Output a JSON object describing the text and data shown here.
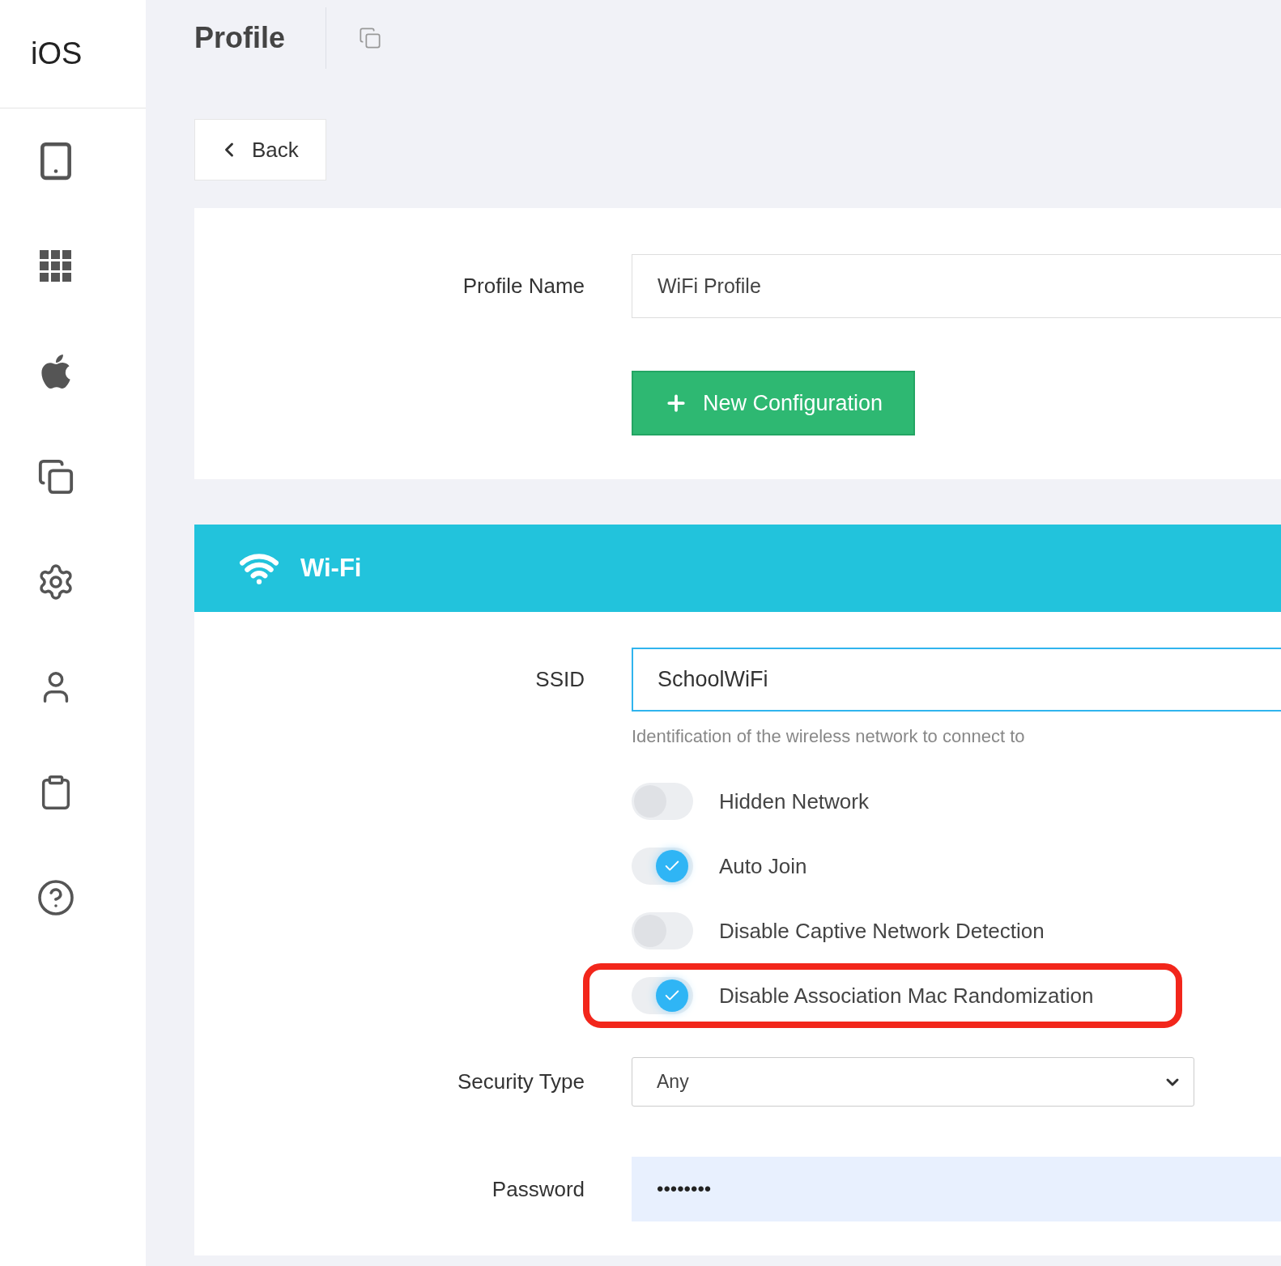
{
  "sidebar": {
    "title": "iOS"
  },
  "header": {
    "title": "Profile"
  },
  "back_button": {
    "label": "Back"
  },
  "profile": {
    "label": "Profile Name",
    "value": "WiFi Profile",
    "new_button": "New Configuration"
  },
  "wifi": {
    "title": "Wi-Fi",
    "ssid": {
      "label": "SSID",
      "value": "SchoolWiFi",
      "help": "Identification of the wireless network to connect to"
    },
    "toggles": [
      {
        "label": "Hidden Network",
        "on": false,
        "highlighted": false
      },
      {
        "label": "Auto Join",
        "on": true,
        "highlighted": false
      },
      {
        "label": "Disable Captive Network Detection",
        "on": false,
        "highlighted": false
      },
      {
        "label": "Disable Association Mac Randomization",
        "on": true,
        "highlighted": true
      }
    ],
    "security": {
      "label": "Security Type",
      "value": "Any"
    },
    "password": {
      "label": "Password",
      "value": "••••••••"
    }
  }
}
